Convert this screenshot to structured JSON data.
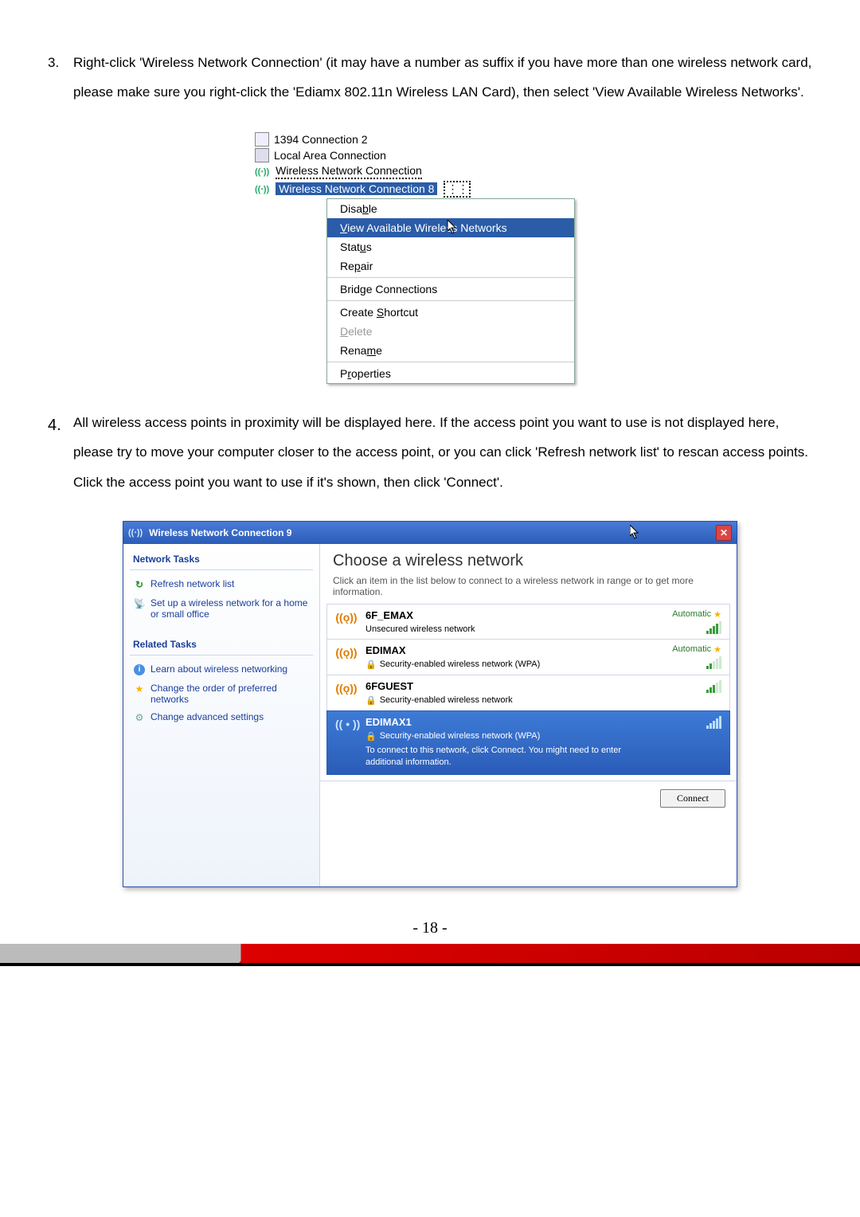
{
  "step3": {
    "num": "3.",
    "text": "Right-click 'Wireless Network Connection' (it may have a number as suffix if you have more than one wireless network card, please make sure you right-click the 'Ediamx 802.11n Wireless LAN Card), then select 'View Available Wireless Networks'."
  },
  "conn": {
    "c1394": "1394 Connection 2",
    "lan": "Local Area Connection",
    "wifi": "Wireless Network Connection",
    "wifi8": "Wireless Network Connection 8"
  },
  "ctx": {
    "disable": "Disable",
    "view": "View Available Wireless Networks",
    "status": "Status",
    "repair": "Repair",
    "bridge": "Bridge Connections",
    "shortcut": "Create Shortcut",
    "delete": "Delete",
    "rename": "Rename",
    "properties": "Properties"
  },
  "step4": {
    "num": "4.",
    "text": "All wireless access points in proximity will be displayed here. If the access point you want to use is not displayed here, please try to move your computer closer to the access point, or you can click 'Refresh network list' to rescan access points. Click the access point you want to use if it's shown, then click 'Connect'."
  },
  "dlg": {
    "title": "Wireless Network Connection 9",
    "choose": "Choose a wireless network",
    "desc": "Click an item in the list below to connect to a wireless network in range or to get more information.",
    "side": {
      "tasks": "Network Tasks",
      "refresh": "Refresh network list",
      "setup": "Set up a wireless network for a home or small office",
      "related": "Related Tasks",
      "learn": "Learn about wireless networking",
      "order": "Change the order of preferred networks",
      "adv": "Change advanced settings"
    },
    "nets": {
      "n1": {
        "name": "6F_EMAX",
        "sub": "Unsecured wireless network",
        "badge": "Automatic"
      },
      "n2": {
        "name": "EDIMAX",
        "sub": "Security-enabled wireless network (WPA)",
        "badge": "Automatic"
      },
      "n3": {
        "name": "6FGUEST",
        "sub": "Security-enabled wireless network"
      },
      "n4": {
        "name": "EDIMAX1",
        "sub": "Security-enabled wireless network (WPA)",
        "extra": "To connect to this network, click Connect. You might need to enter additional information."
      }
    },
    "connect": "Connect"
  },
  "page": "- 18 -"
}
